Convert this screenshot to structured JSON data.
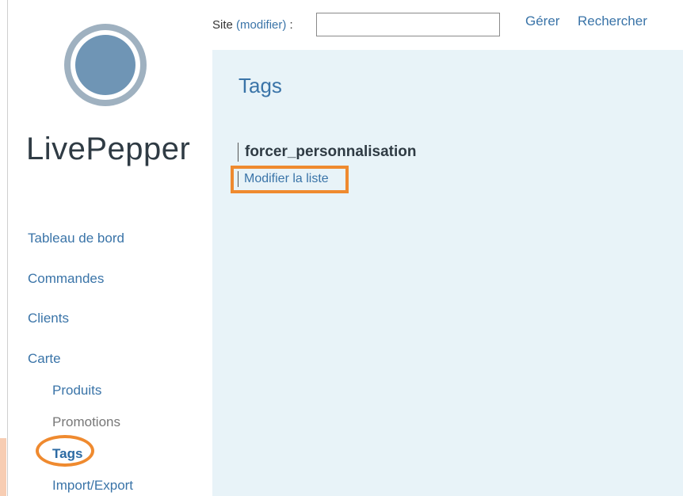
{
  "brand": {
    "name": "LivePepper",
    "logo": "livepepper-logo-icon"
  },
  "header": {
    "site_label": "Site ",
    "site_modifier": "(modifier)",
    "site_colon": " :",
    "site_value": "",
    "links": {
      "manage": "Gérer",
      "search": "Rechercher"
    }
  },
  "sidebar": {
    "items": [
      {
        "label": "Tableau de bord"
      },
      {
        "label": "Commandes"
      },
      {
        "label": "Clients"
      },
      {
        "label": "Carte"
      }
    ],
    "sub_items": [
      {
        "label": "Produits"
      },
      {
        "label": "Promotions"
      },
      {
        "label": "Tags",
        "active": true
      },
      {
        "label": "Import/Export"
      }
    ]
  },
  "main": {
    "title": "Tags",
    "tag": {
      "name": "forcer_personnalisation",
      "action": "Modifier la liste"
    }
  },
  "colors": {
    "accent": "#3a74a8",
    "highlight": "#ef8a2f",
    "panel_bg": "#e8f3f8"
  }
}
